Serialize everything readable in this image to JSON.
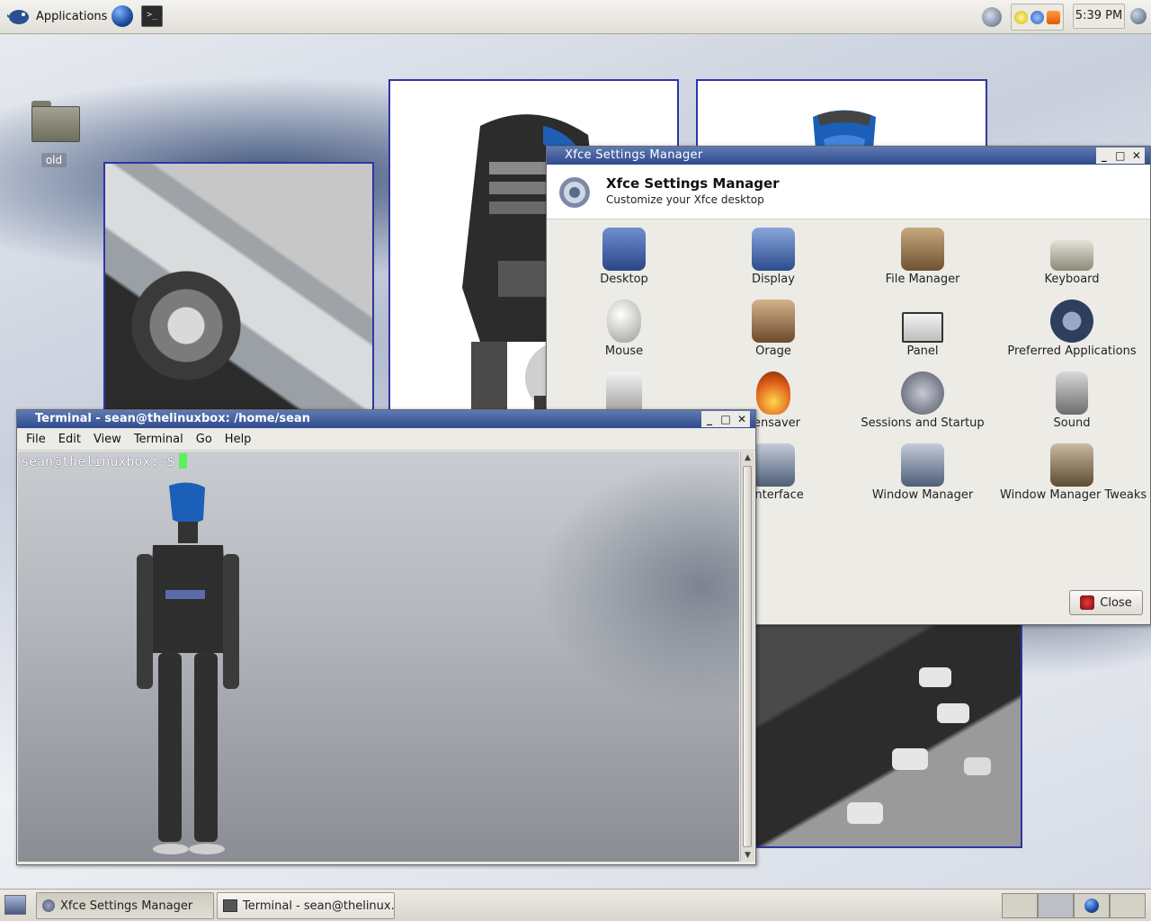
{
  "top_panel": {
    "applications_label": "Applications",
    "clock": "5:39 PM",
    "icons": [
      "xfce-mouse-icon",
      "globe-icon",
      "terminal-icon",
      "network-icon",
      "lightbulb-icon",
      "update-icon",
      "rss-icon",
      "quit-icon"
    ]
  },
  "desktop": {
    "icons": [
      {
        "label": "old",
        "icon": "folder-icon"
      }
    ]
  },
  "settings_window": {
    "title": "Xfce Settings Manager",
    "header_title": "Xfce Settings Manager",
    "header_subtitle": "Customize your Xfce desktop",
    "items": [
      {
        "label": "Desktop",
        "icon": "desktop-settings-icon",
        "color": "#3a5fa8"
      },
      {
        "label": "Display",
        "icon": "display-icon",
        "color": "#3b5ea6"
      },
      {
        "label": "File Manager",
        "icon": "file-manager-icon",
        "color": "#8a6d4a"
      },
      {
        "label": "Keyboard",
        "icon": "keyboard-icon",
        "color": "#9a9a8a"
      },
      {
        "label": "Mouse",
        "icon": "mouse-icon",
        "color": "#c9c9c4"
      },
      {
        "label": "Orage",
        "icon": "calendar-icon",
        "color": "#7a5a3a"
      },
      {
        "label": "Panel",
        "icon": "panel-icon",
        "color": "#333333"
      },
      {
        "label": "Preferred Applications",
        "icon": "gear-icon",
        "color": "#3a4a6a"
      },
      {
        "label": "",
        "icon": "printer-icon",
        "color": "#bdbdbd"
      },
      {
        "label": "eensaver",
        "icon": "screensaver-icon",
        "color": "#d2691e"
      },
      {
        "label": "Sessions and Startup",
        "icon": "sessions-icon",
        "color": "#6a6a7a"
      },
      {
        "label": "Sound",
        "icon": "sound-icon",
        "color": "#8a8a8a"
      },
      {
        "label": "r interface",
        "icon": "user-interface-icon",
        "color": "#5a6a8a"
      },
      {
        "label": "Window Manager",
        "icon": "window-manager-icon",
        "color": "#5a6a8a"
      },
      {
        "label": "Window Manager Tweaks",
        "icon": "wm-tweaks-icon",
        "color": "#6a5a4a"
      }
    ],
    "close_label": "Close"
  },
  "terminal_window": {
    "title": "Terminal - sean@thelinuxbox: /home/sean",
    "menu": [
      "File",
      "Edit",
      "View",
      "Terminal",
      "Go",
      "Help"
    ],
    "prompt": "sean@thelinuxbox:~$"
  },
  "bottom_panel": {
    "tasks": [
      {
        "label": "Xfce Settings Manager",
        "active": true
      },
      {
        "label": "Terminal - sean@thelinux...",
        "active": false
      }
    ]
  }
}
